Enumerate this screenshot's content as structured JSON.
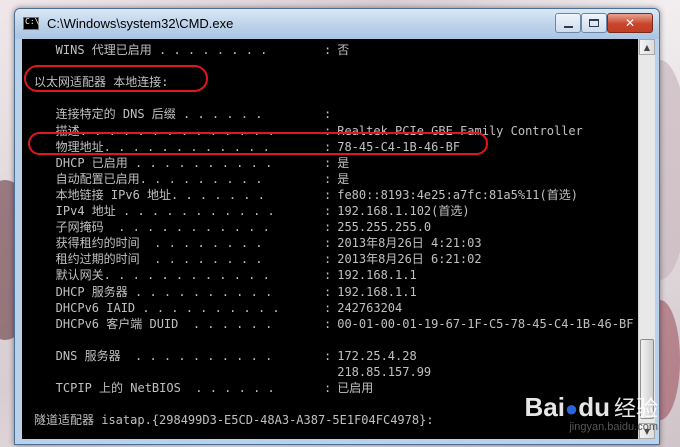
{
  "window": {
    "title": "C:\\Windows\\system32\\CMD.exe",
    "controls": {
      "minimize": "",
      "maximize": "",
      "close": "✕"
    }
  },
  "console": {
    "lines": [
      {
        "label": "   WINS 代理已启用 . . . . . . . .",
        "sep": ":",
        "value": " 否"
      },
      {
        "label": "",
        "sep": "",
        "value": ""
      },
      {
        "label": "以太网适配器 本地连接:",
        "sep": "",
        "value": ""
      },
      {
        "label": "",
        "sep": "",
        "value": ""
      },
      {
        "label": "   连接特定的 DNS 后缀 . . . . . .",
        "sep": ":",
        "value": ""
      },
      {
        "label": "   描述. . . . . . . . . . . . . .",
        "sep": ":",
        "value": " Realtek PCIe GBE Family Controller"
      },
      {
        "label": "   物理地址. . . . . . . . . . . .",
        "sep": ":",
        "value": " 78-45-C4-1B-46-BF"
      },
      {
        "label": "   DHCP 已启用 . . . . . . . . . .",
        "sep": ":",
        "value": " 是"
      },
      {
        "label": "   自动配置已启用. . . . . . . . .",
        "sep": ":",
        "value": " 是"
      },
      {
        "label": "   本地链接 IPv6 地址. . . . . . .",
        "sep": ":",
        "value": " fe80::8193:4e25:a7fc:81a5%11(首选)"
      },
      {
        "label": "   IPv4 地址 . . . . . . . . . . .",
        "sep": ":",
        "value": " 192.168.1.102(首选)"
      },
      {
        "label": "   子网掩码  . . . . . . . . . . .",
        "sep": ":",
        "value": " 255.255.255.0"
      },
      {
        "label": "   获得租约的时间  . . . . . . . .",
        "sep": ":",
        "value": " 2013年8月26日 4:21:03"
      },
      {
        "label": "   租约过期的时间  . . . . . . . .",
        "sep": ":",
        "value": " 2013年8月26日 6:21:02"
      },
      {
        "label": "   默认网关. . . . . . . . . . . .",
        "sep": ":",
        "value": " 192.168.1.1"
      },
      {
        "label": "   DHCP 服务器 . . . . . . . . . .",
        "sep": ":",
        "value": " 192.168.1.1"
      },
      {
        "label": "   DHCPv6 IAID . . . . . . . . . .",
        "sep": ":",
        "value": " 242763204"
      },
      {
        "label": "   DHCPv6 客户端 DUID  . . . . . .",
        "sep": ":",
        "value": " 00-01-00-01-19-67-1F-C5-78-45-C4-1B-46-BF"
      },
      {
        "label": "",
        "sep": "",
        "value": ""
      },
      {
        "label": "   DNS 服务器  . . . . . . . . . .",
        "sep": ":",
        "value": " 172.25.4.28"
      },
      {
        "label": "",
        "sep": "",
        "value": " 218.85.157.99"
      },
      {
        "label": "   TCPIP 上的 NetBIOS  . . . . . .",
        "sep": ":",
        "value": " 已启用"
      },
      {
        "label": "",
        "sep": "",
        "value": ""
      },
      {
        "label": "隧道适配器 isatap.{298499D3-E5CD-48A3-A387-5E1F04FC4978}:",
        "sep": "",
        "value": ""
      }
    ]
  },
  "watermark": {
    "logo": "Bai",
    "logo_mid": "du",
    "logo_suffix": "经验",
    "url": "jingyan.baidu.com"
  },
  "colors": {
    "console_bg": "#000000",
    "console_text": "#c0c0c0",
    "annotation": "#e0181d",
    "close_button": "#c9462c"
  }
}
